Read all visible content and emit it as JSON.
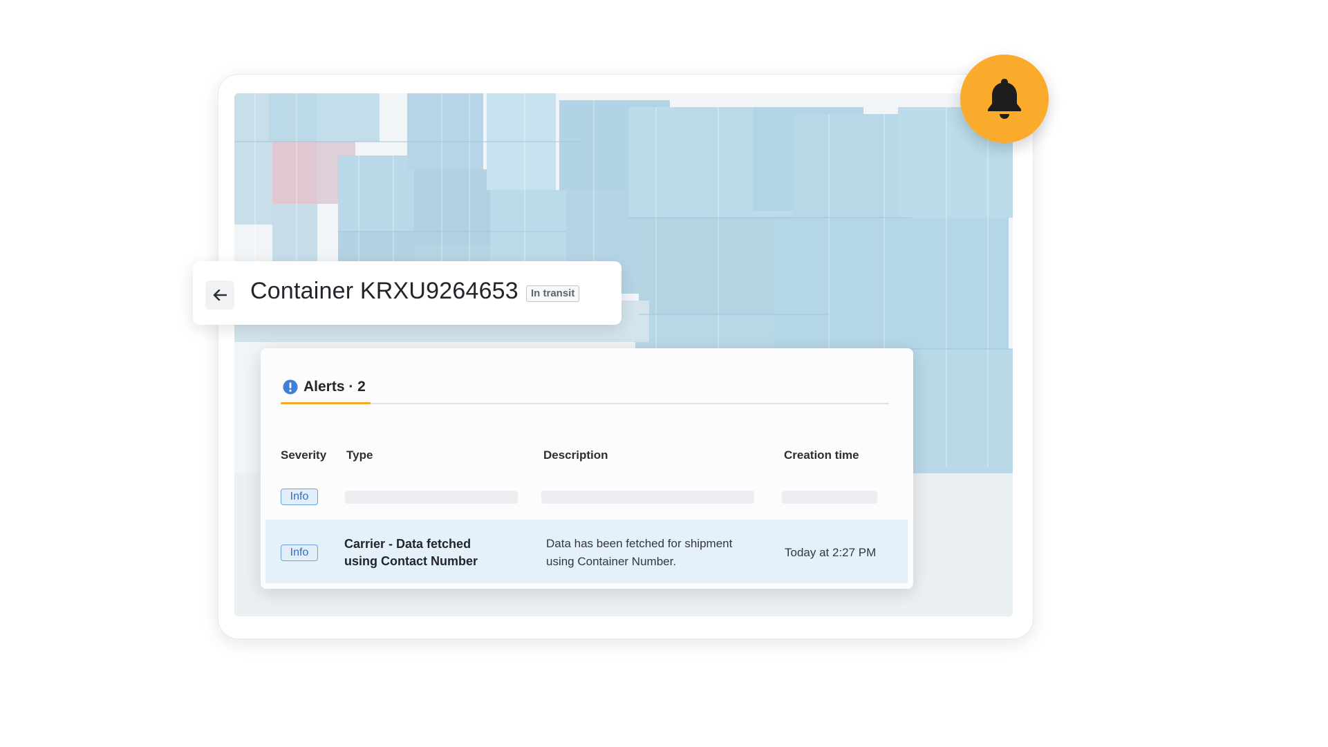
{
  "container": {
    "title": "Container KRXU9264653",
    "status": "In transit"
  },
  "alerts": {
    "tab_label": "Alerts · 2",
    "columns": [
      "Severity",
      "Type",
      "Description",
      "Creation time"
    ],
    "rows": [
      {
        "severity": "Info",
        "loading": true
      },
      {
        "severity": "Info",
        "type": "Carrier - Data fetched using Contact Number",
        "description": "Data has been fetched for shipment using Container Number.",
        "creation_time": "Today at 2:27 PM"
      }
    ]
  },
  "icons": {
    "back": "arrow-left-icon",
    "notification": "bell-icon",
    "alert": "exclamation-circle-icon"
  },
  "colors": {
    "accent": "#fbab2b",
    "tab_underline": "#f5a623",
    "info_badge": "#2d6fc2",
    "row_highlight": "#e4f1fb"
  }
}
